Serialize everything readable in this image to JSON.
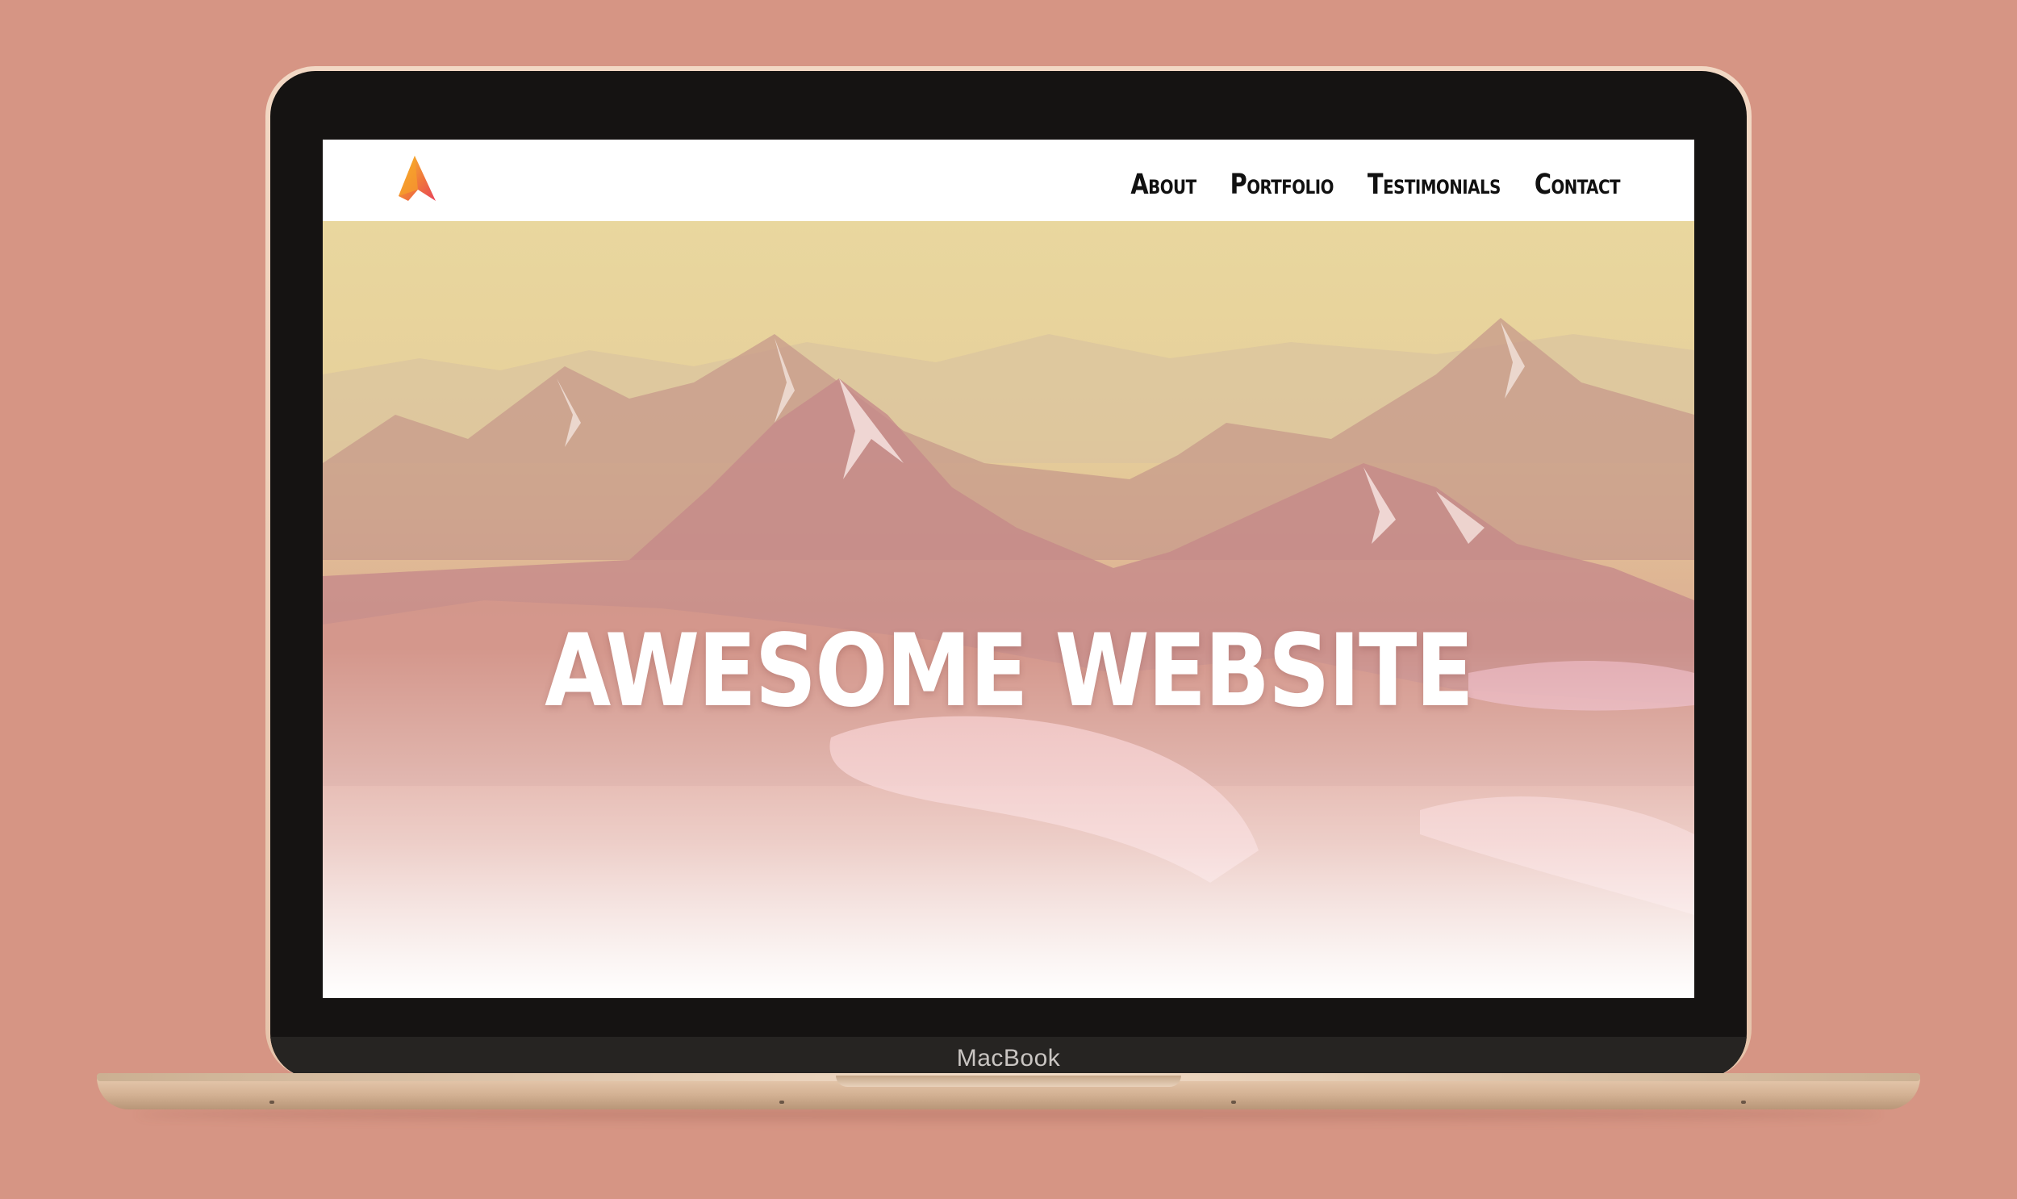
{
  "device": {
    "brand_label": "MacBook"
  },
  "site": {
    "logo": {
      "icon": "mountain-peak-logo",
      "colors": [
        "#f9c22e",
        "#f07a3a",
        "#e8435a"
      ]
    },
    "nav": {
      "items": [
        {
          "label": "About"
        },
        {
          "label": "Portfolio"
        },
        {
          "label": "Testimonials"
        },
        {
          "label": "Contact"
        }
      ]
    },
    "hero": {
      "title": "AWESOME WEBSITE"
    }
  },
  "colors": {
    "background": "#d69584",
    "bezel": "#151312",
    "hero_tint_top": "#e8d39a",
    "hero_tint_bottom": "#ffffff"
  }
}
